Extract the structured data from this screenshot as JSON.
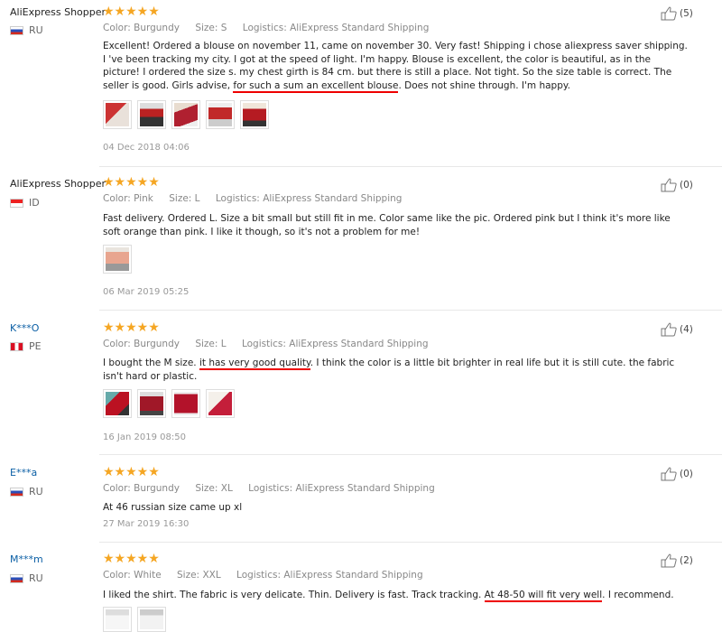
{
  "reviews": [
    {
      "user": "AliExpress Shopper",
      "country": "RU",
      "stars": "★★★★★",
      "color_label": "Color:",
      "color": "Burgundy",
      "size_label": "Size:",
      "size": "S",
      "logistics_label": "Logistics:",
      "logistics": "AliExpress Standard Shipping",
      "text_a": "Excellent! Ordered a blouse on november 11, came on november 30. Very fast! Shipping i chose aliexpress saver shipping. I 've been tracking my city. I got at the speed of light. I'm happy. Blouse is excellent, the color is beautiful, as in the picture! I ordered the size s. my chest girth is 84 cm. but there is still a place. Not tight. So the size table is correct. The seller is good. Girls advise, ",
      "text_hl": "for such a sum an excellent blouse",
      "text_b": ". Does not shine through. I'm happy.",
      "date": "04 Dec 2018 04:06",
      "helpful": "(5)"
    },
    {
      "user": "AliExpress Shopper",
      "country": "ID",
      "stars": "★★★★★",
      "color_label": "Color:",
      "color": "Pink",
      "size_label": "Size:",
      "size": "L",
      "logistics_label": "Logistics:",
      "logistics": "AliExpress Standard Shipping",
      "text_a": "Fast delivery. Ordered L. Size a bit small but still fit in me. Color same like the pic. Ordered pink but I think it's more like soft orange than pink. I like it though, so it's not a problem for me!",
      "date": "06 Mar 2019 05:25",
      "helpful": "(0)"
    },
    {
      "user": "K***O",
      "country": "PE",
      "stars": "★★★★★",
      "color_label": "Color:",
      "color": "Burgundy",
      "size_label": "Size:",
      "size": "L",
      "logistics_label": "Logistics:",
      "logistics": "AliExpress Standard Shipping",
      "text_a": "I bought the M size. ",
      "text_hl": "it has very good quality",
      "text_b": ". I think the color is a little bit brighter in real life but it is still cute. the fabric isn't hard or plastic.",
      "date": "16 Jan 2019 08:50",
      "helpful": "(4)"
    },
    {
      "user": "E***a",
      "country": "RU",
      "stars": "★★★★★",
      "color_label": "Color:",
      "color": "Burgundy",
      "size_label": "Size:",
      "size": "XL",
      "logistics_label": "Logistics:",
      "logistics": "AliExpress Standard Shipping",
      "text_a": "At 46 russian size came up xl",
      "date": "27 Mar 2019 16:30",
      "helpful": "(0)"
    },
    {
      "user": "M***m",
      "country": "RU",
      "stars": "★★★★★",
      "color_label": "Color:",
      "color": "White",
      "size_label": "Size:",
      "size": "XXL",
      "logistics_label": "Logistics:",
      "logistics": "AliExpress Standard Shipping",
      "text_a": "I liked the shirt. The fabric is very delicate. Thin. Delivery is fast. Track tracking. ",
      "text_hl": "At 48-50 will fit very well",
      "text_b": ". I recommend.",
      "helpful": "(2)"
    }
  ],
  "colors": {
    "star": "#f5a623",
    "link": "#0b5fa5",
    "annotation": "#e00000"
  },
  "icons": {
    "helpful": "thumbs-up-icon",
    "flag": "flag-icon"
  }
}
